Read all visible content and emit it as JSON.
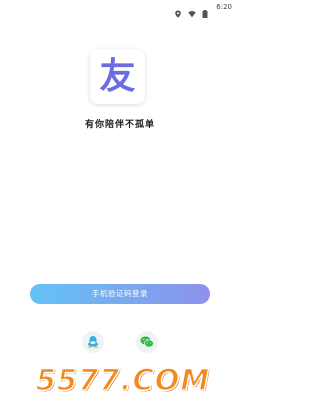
{
  "status_bar": {
    "time": "6:20",
    "icons": [
      "location-icon",
      "wifi-icon",
      "battery-icon"
    ]
  },
  "logo": {
    "char": "友",
    "color": "#6a6ee0"
  },
  "slogan": "有你陪伴不孤单",
  "login_button": {
    "label": "手机验证码登录",
    "gradient_start": "#63c3f5",
    "gradient_end": "#8d91ea"
  },
  "social_login": {
    "items": [
      "qq-icon",
      "wechat-icon"
    ]
  },
  "watermark": {
    "text": "5577.COM"
  }
}
